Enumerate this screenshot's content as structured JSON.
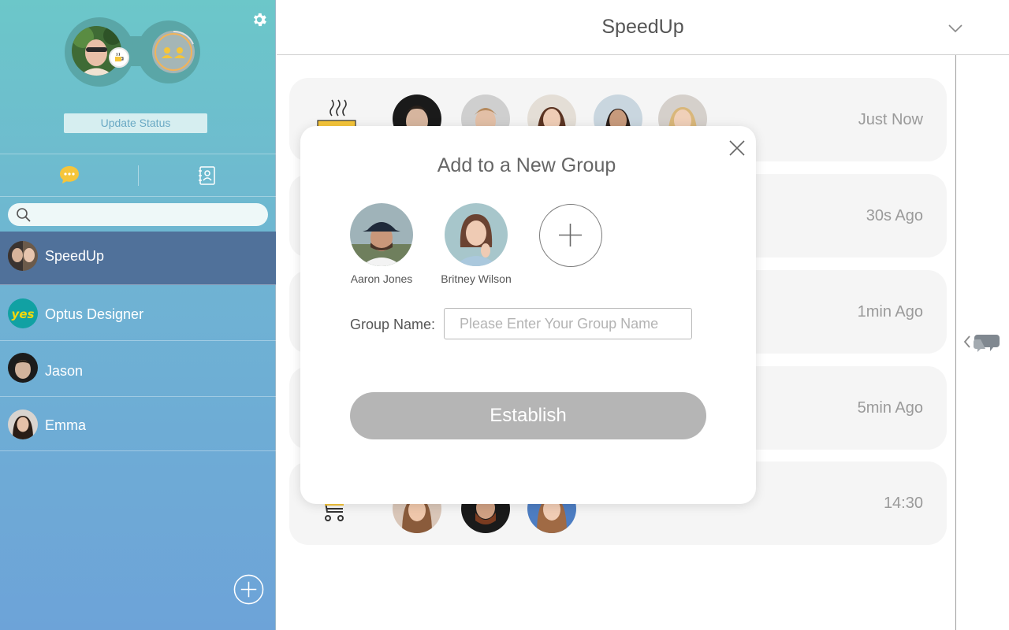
{
  "sidebar": {
    "update_status_label": "Update Status",
    "search": {
      "placeholder": ""
    },
    "contacts": [
      {
        "name": "SpeedUp",
        "active": true
      },
      {
        "name": "Optus Designer",
        "active": false
      },
      {
        "name": "Jason",
        "active": false
      },
      {
        "name": "Emma",
        "active": false
      }
    ],
    "optus_logo_text": "yes"
  },
  "header": {
    "title": "SpeedUp"
  },
  "feed": {
    "cards": [
      {
        "time": "Just Now",
        "icon": "coffee-icon",
        "member_count": 5
      },
      {
        "time": "30s Ago"
      },
      {
        "time": "1min Ago"
      },
      {
        "time": "5min Ago"
      },
      {
        "time": "14:30",
        "icon": "cart-icon",
        "member_count": 3
      }
    ]
  },
  "modal": {
    "title": "Add to a New Group",
    "members": [
      {
        "name": "Aaron Jones"
      },
      {
        "name": "Britney Wilson"
      }
    ],
    "group_name_label": "Group Name:",
    "group_name_placeholder": "Please Enter Your Group Name",
    "group_name_value": "",
    "establish_label": "Establish"
  },
  "colors": {
    "sidebar_top": "#6cc7c9",
    "sidebar_bottom": "#6da3d8",
    "active_contact": "#50719a",
    "accent_yellow": "#f5c53a",
    "establish_disabled": "#b5b5b5"
  }
}
